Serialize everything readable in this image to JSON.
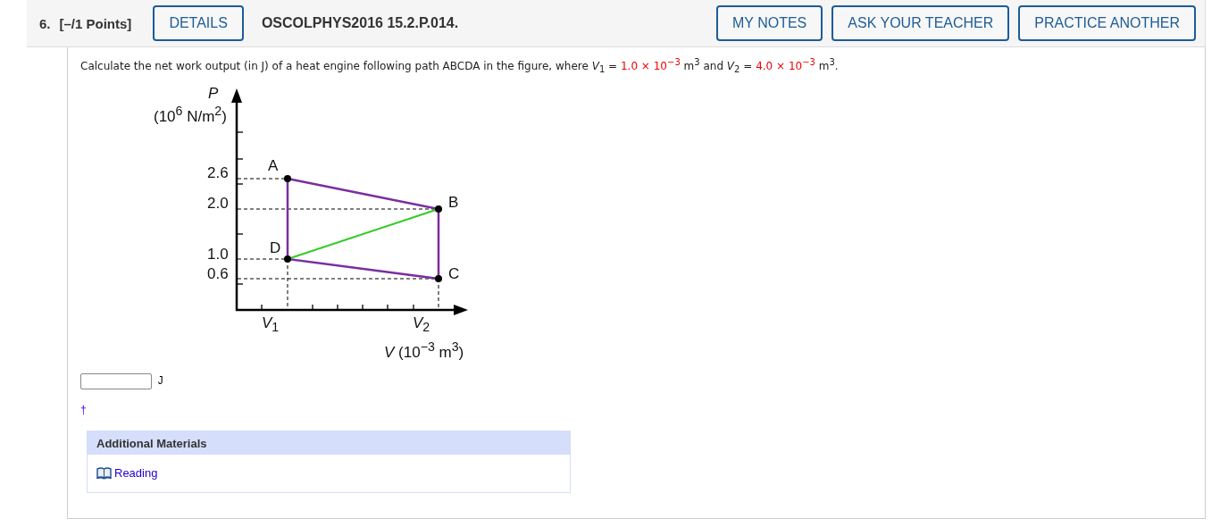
{
  "header": {
    "number": "6.",
    "points": "[–/1 Points]",
    "details_button": "DETAILS",
    "code": "OSCOLPHYS2016 15.2.P.014.",
    "buttons": [
      "MY NOTES",
      "ASK YOUR TEACHER",
      "PRACTICE ANOTHER"
    ]
  },
  "question": {
    "segments": [
      {
        "kind": "text",
        "text": "Calculate the net work output (in J) of a heat engine following path ABCDA in the figure, where *V*$_{1}$ = "
      },
      {
        "kind": "value",
        "text": "1.0 × 10$^{−3}$"
      },
      {
        "kind": "text",
        "text": " m$^{3}$ and *V*$_{2}$ = "
      },
      {
        "kind": "value",
        "text": "4.0 × 10$^{−3}$"
      },
      {
        "kind": "text",
        "text": " m$^{3}$."
      }
    ]
  },
  "figure": {
    "y_axis_label": "P",
    "y_axis_unit": "(10$^{6}$ N/m$^{2}$)",
    "y_ticks": [
      "2.6",
      "2.0",
      "1.0",
      "0.6"
    ],
    "x_ticks": [
      "*V*$_{1}$",
      "*V*$_{2}$"
    ],
    "x_axis_label": "*V* (10$^{−3}$ m$^{3}$)",
    "points": [
      "A",
      "B",
      "C",
      "D"
    ]
  },
  "answer": {
    "unit": "J",
    "marker": "†"
  },
  "additional_materials": {
    "title": "Additional Materials",
    "links": [
      "Reading"
    ]
  }
}
